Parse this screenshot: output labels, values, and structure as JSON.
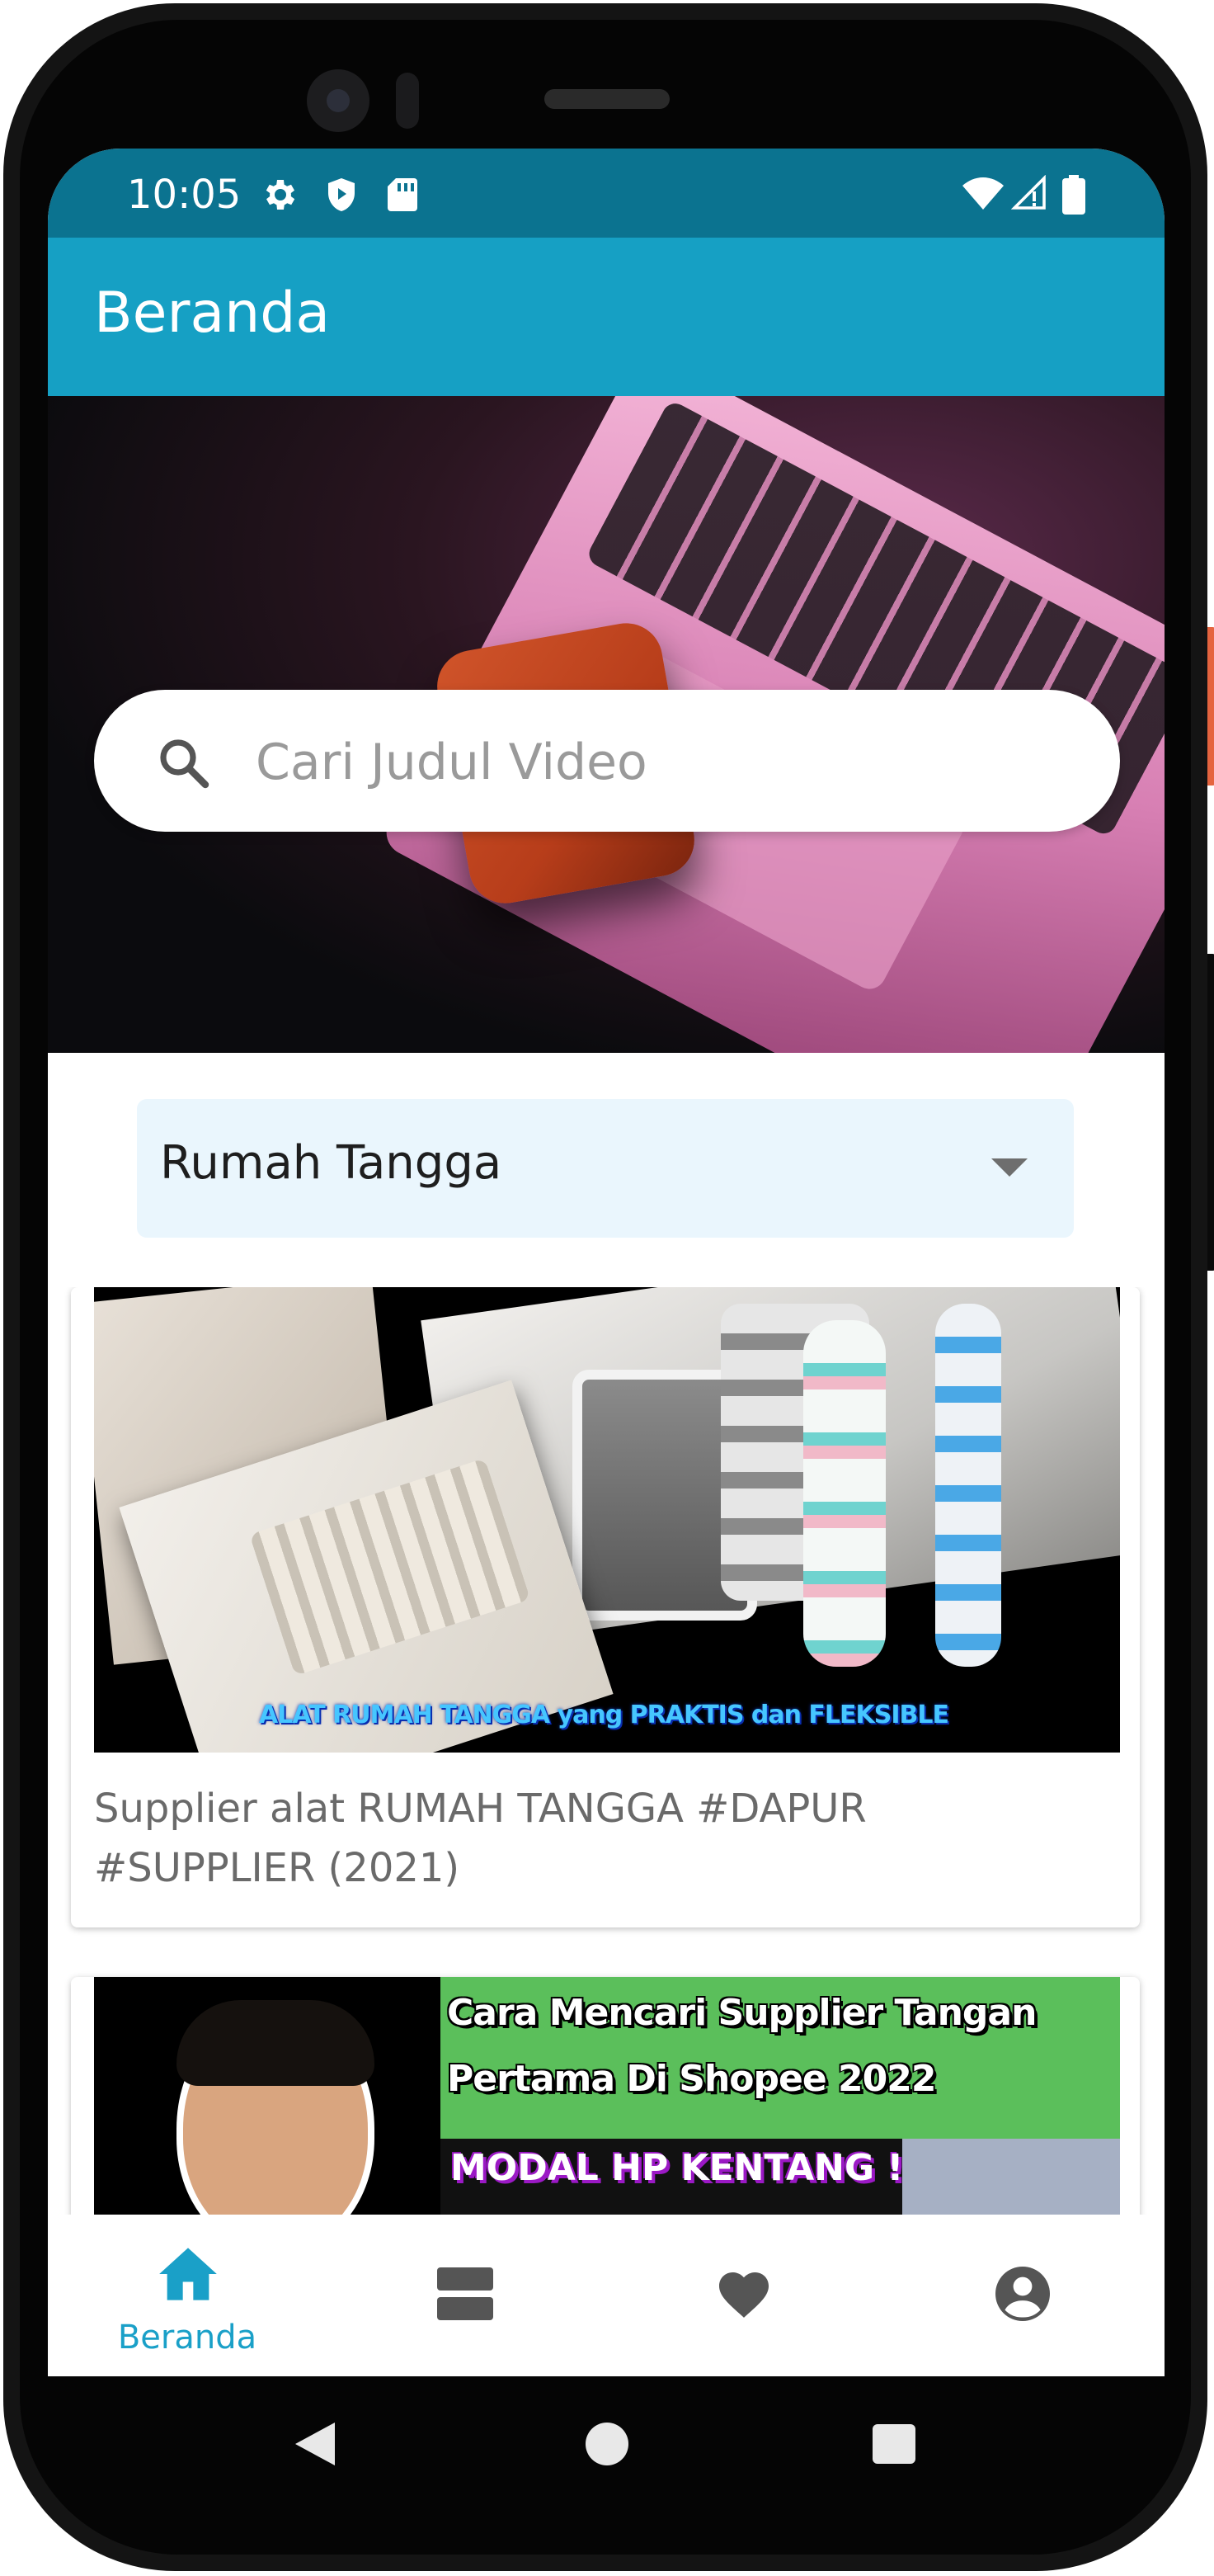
{
  "status_bar": {
    "time": "10:05"
  },
  "app_bar": {
    "title": "Beranda"
  },
  "search": {
    "placeholder": "Cari Judul Video"
  },
  "carousel": {
    "slide_count": 4,
    "active_index": 3
  },
  "category_dropdown": {
    "selected": "Rumah Tangga"
  },
  "videos": [
    {
      "thumbnail_caption": "ALAT RUMAH TANGGA yang PRAKTIS dan FLEKSIBLE",
      "title": "Supplier alat RUMAH TANGGA #DAPUR #SUPPLIER (2021)"
    },
    {
      "thumbnail_lines": [
        "Cara Mencari Supplier Tangan",
        "Pertama Di Shopee 2022",
        "MODAL HP KENTANG !"
      ],
      "title": ""
    }
  ],
  "bottom_nav": {
    "items": [
      {
        "icon": "home-icon",
        "label": "Beranda",
        "active": true
      },
      {
        "icon": "view-agenda-icon",
        "label": "",
        "active": false
      },
      {
        "icon": "heart-icon",
        "label": "",
        "active": false
      },
      {
        "icon": "account-circle-icon",
        "label": "",
        "active": false
      }
    ]
  },
  "colors": {
    "status_bar": "#0b7390",
    "app_bar": "#16a0c4",
    "active_nav": "#1aa0c8",
    "inactive_nav": "#555555",
    "dropdown_bg": "#eaf6fd"
  }
}
